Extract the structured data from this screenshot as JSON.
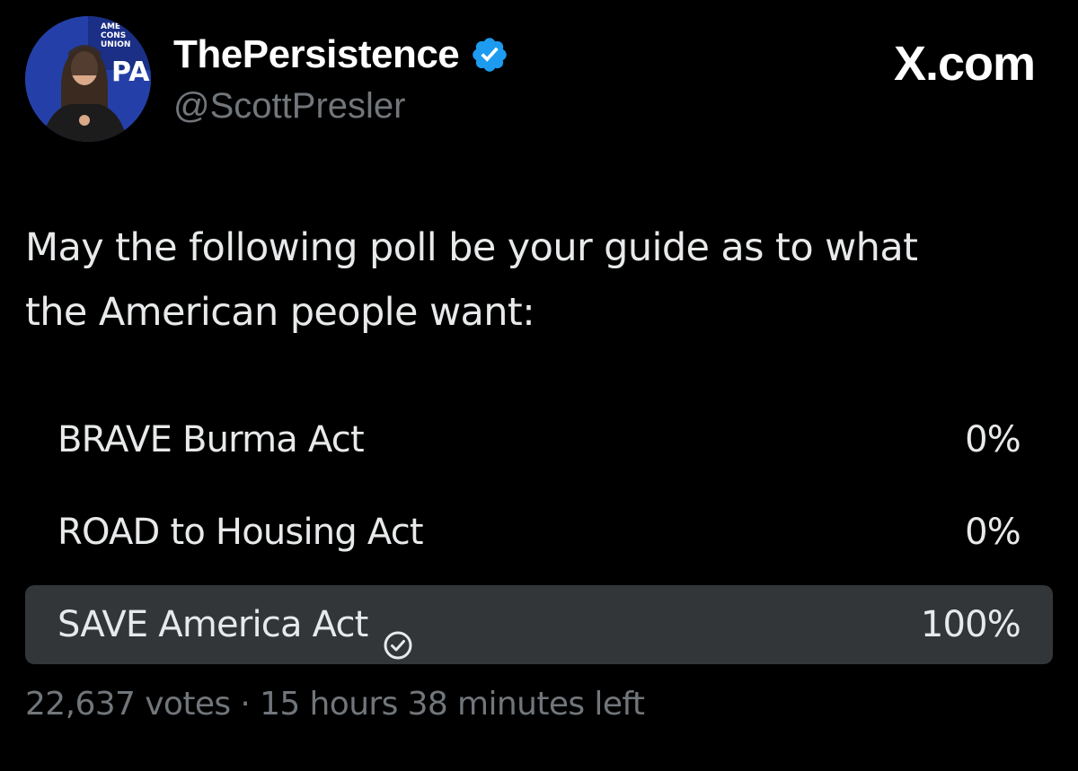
{
  "author": {
    "display_name": "ThePersistence",
    "handle": "@ScottPresler",
    "verified": true,
    "avatar_icon": "profile-photo",
    "avatar_backdrop_text": "AMERICAN CONSERVATIVE UNION",
    "avatar_backdrop_logo": "CPA"
  },
  "source": {
    "label": "X.com"
  },
  "tweet": {
    "text_line1": "May the following poll be your guide as to what",
    "text_line2": "the American people want:"
  },
  "poll": {
    "options": [
      {
        "label": "BRAVE Burma Act",
        "percent_text": "0%",
        "share": 0,
        "selected": false
      },
      {
        "label": "ROAD to Housing Act",
        "percent_text": "0%",
        "share": 0,
        "selected": false
      },
      {
        "label": "SAVE America Act",
        "percent_text": "100%",
        "share": 1,
        "selected": true
      }
    ],
    "votes_text": "22,637 votes",
    "separator": "·",
    "time_left_text": "15 hours 38 minutes left"
  },
  "colors": {
    "background": "#000000",
    "primary_text": "#e7e9ea",
    "secondary_text": "#71767b",
    "verified_blue": "#1d9bf0",
    "poll_fill": "#333639"
  }
}
